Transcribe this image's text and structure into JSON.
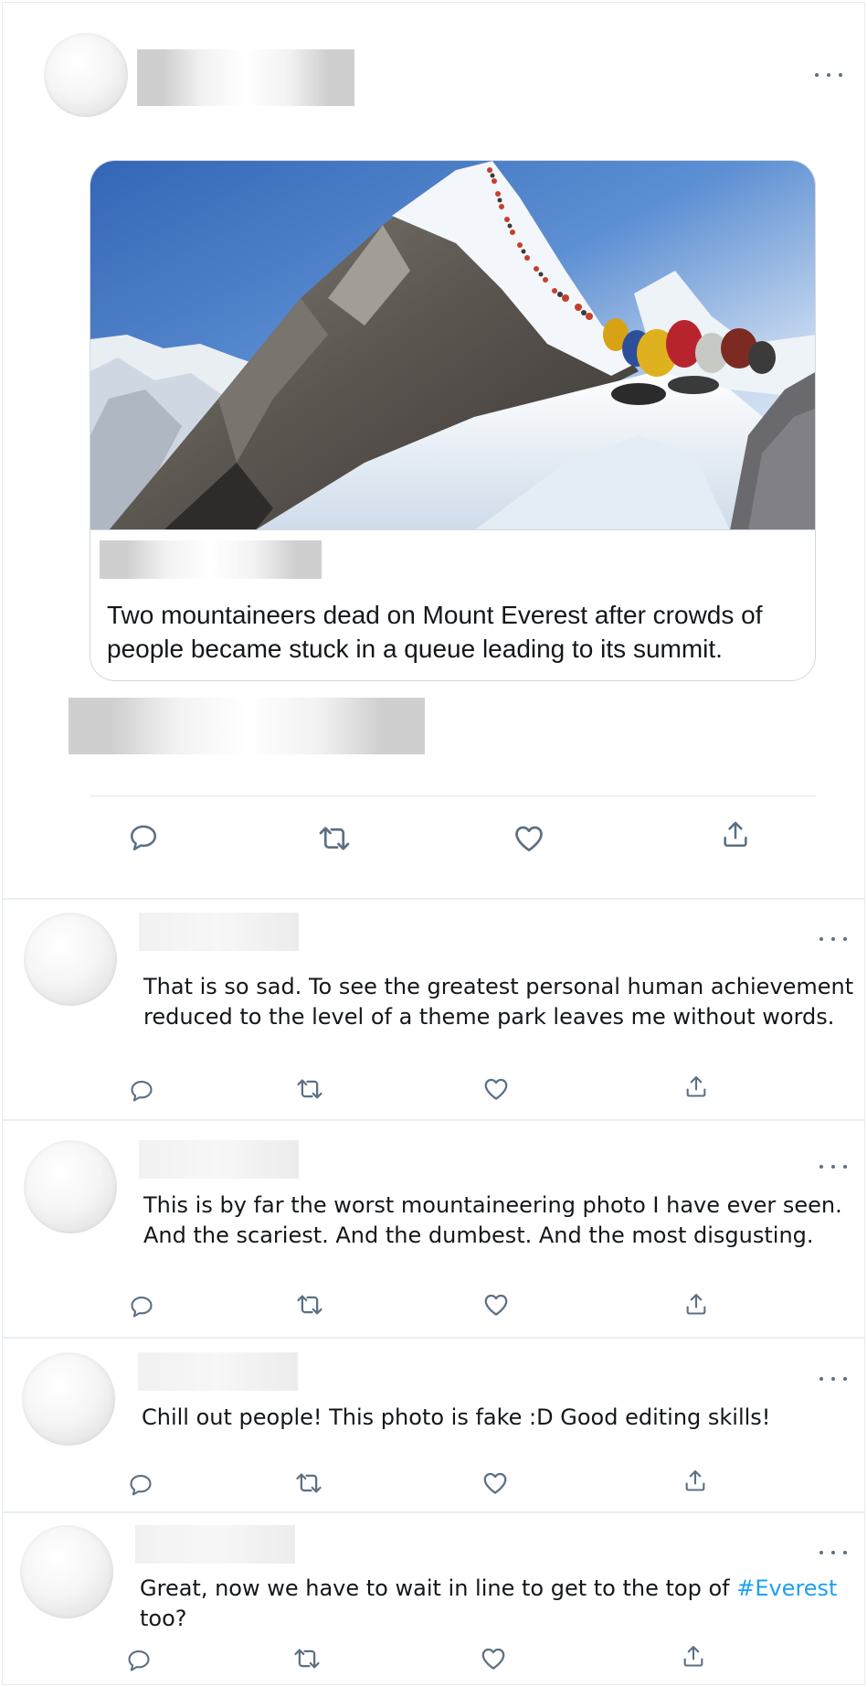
{
  "main_tweet": {
    "card": {
      "headline": "Two mountaineers dead on Mount Everest after crowds of people became stuck in a queue leading to its summit."
    },
    "actions": [
      "reply-icon",
      "retweet-icon",
      "like-icon",
      "share-icon"
    ]
  },
  "replies": [
    {
      "line1": "That is so sad. To see the greatest personal human achievement",
      "line2": "reduced to the level of a theme park leaves me without words."
    },
    {
      "line1": "This is by far the worst mountaineering photo I have ever seen.",
      "line2": "And the scariest. And the dumbest. And the most disgusting."
    },
    {
      "line1": "Chill out people! This photo is fake :D Good editing skills!",
      "line2": ""
    },
    {
      "line1": "Great, now we have to wait in line to get to the top of ",
      "hashtag": "#Everest",
      "line2": "too?"
    }
  ],
  "colors": {
    "icon": "#5b7083",
    "hashtag": "#1da1f2",
    "border": "#cfd9de"
  }
}
